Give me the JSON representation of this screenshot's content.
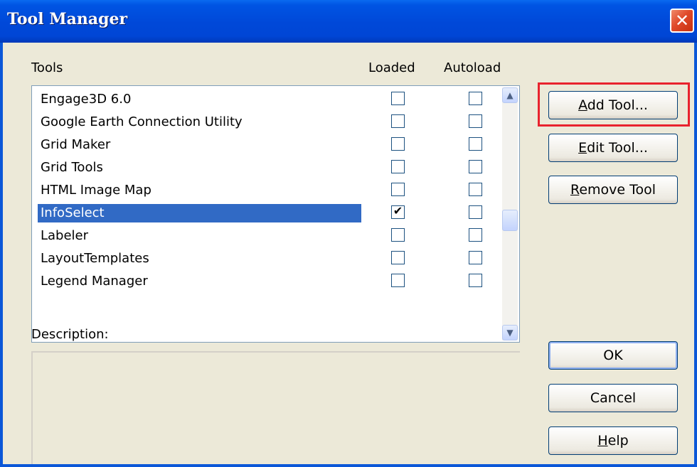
{
  "window": {
    "title": "Tool Manager",
    "close_glyph": "✕"
  },
  "columns": {
    "tools": "Tools",
    "loaded": "Loaded",
    "autoload": "Autoload"
  },
  "tools": [
    {
      "name": "Engage3D 6.0",
      "loaded": false,
      "autoload": false,
      "selected": false
    },
    {
      "name": "Google Earth Connection Utility",
      "loaded": false,
      "autoload": false,
      "selected": false
    },
    {
      "name": "Grid Maker",
      "loaded": false,
      "autoload": false,
      "selected": false
    },
    {
      "name": "Grid Tools",
      "loaded": false,
      "autoload": false,
      "selected": false
    },
    {
      "name": "HTML Image Map",
      "loaded": false,
      "autoload": false,
      "selected": false
    },
    {
      "name": "InfoSelect",
      "loaded": true,
      "autoload": false,
      "selected": true
    },
    {
      "name": "Labeler",
      "loaded": false,
      "autoload": false,
      "selected": false
    },
    {
      "name": "LayoutTemplates",
      "loaded": false,
      "autoload": false,
      "selected": false
    },
    {
      "name": "Legend Manager",
      "loaded": false,
      "autoload": false,
      "selected": false
    }
  ],
  "buttons": {
    "add_tool": {
      "pre": "",
      "mn": "A",
      "post": "dd Tool..."
    },
    "edit_tool": {
      "pre": "",
      "mn": "E",
      "post": "dit Tool..."
    },
    "remove_tool": {
      "pre": "",
      "mn": "R",
      "post": "emove Tool"
    },
    "ok": "OK",
    "cancel": "Cancel",
    "help": {
      "pre": "",
      "mn": "H",
      "post": "elp"
    }
  },
  "description": {
    "label": "Description:",
    "text": ""
  },
  "scrollbar": {
    "up_glyph": "▲",
    "down_glyph": "▼"
  },
  "highlight_color": "#e8232e"
}
